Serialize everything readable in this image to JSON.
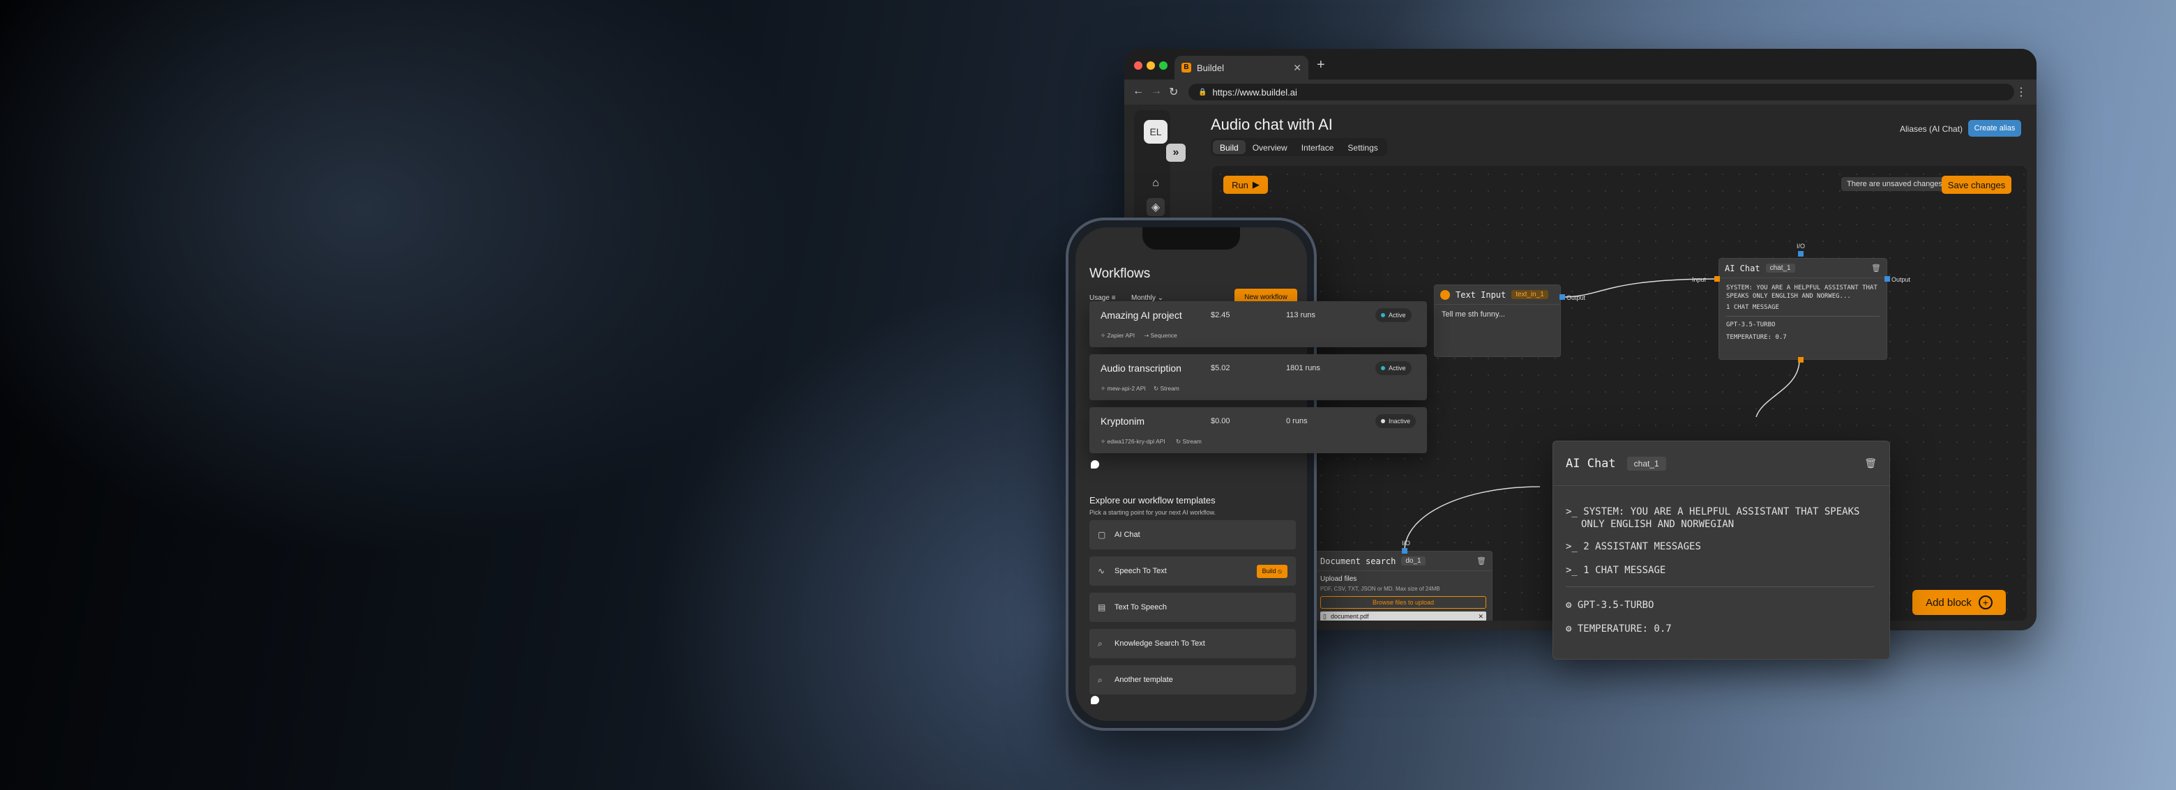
{
  "browser": {
    "tab_title": "Buildel",
    "favicon_letter": "B",
    "url": "https://www.buildel.ai",
    "new_tab_icon": "+",
    "traffic_lights": [
      "#ff5f57",
      "#febc2e",
      "#28c840"
    ]
  },
  "app": {
    "avatar": "EL",
    "page_title": "Audio chat with AI",
    "tabs": [
      {
        "label": "Build",
        "active": true
      },
      {
        "label": "Overview",
        "active": false
      },
      {
        "label": "Interface",
        "active": false
      },
      {
        "label": "Settings",
        "active": false
      }
    ],
    "aliases_label": "Aliases (AI Chat)",
    "create_alias": "Create alias",
    "run_label": "Run",
    "unsaved_text": "There are unsaved changes",
    "save_label": "Save changes",
    "add_block_label": "Add block",
    "accent": "#f08c00"
  },
  "nodes": {
    "text_input": {
      "title": "Text Input",
      "tag": "text_in_1",
      "body": "Tell me sth funny...",
      "output_label": "Output"
    },
    "ai_chat_small": {
      "title": "AI Chat",
      "tag": "chat_1",
      "io_label": "I/O",
      "input_label": "Input",
      "output_label": "Output",
      "system": "SYSTEM: YOU ARE A HELPFUL ASSISTANT THAT SPEAKS ONLY ENGLISH AND NORWEG...",
      "messages": "1 CHAT MESSAGE",
      "model": "GPT-3.5-TURBO",
      "temperature": "TEMPERATURE: 0.7"
    },
    "document_search": {
      "title": "Document search",
      "tag": "do_1",
      "io_label": "I/O",
      "upload_title": "Upload files",
      "upload_hint": "PDF, CSV, TXT, JSON or MD. Max size of 24MB",
      "browse_label": "Browse files to upload",
      "file_name": "document.pdf"
    }
  },
  "big_card": {
    "title": "AI Chat",
    "tag": "chat_1",
    "system": "SYSTEM: YOU ARE A HELPFUL ASSISTANT THAT SPEAKS",
    "system2": "ONLY ENGLISH AND NORWEGIAN",
    "assistant": "2 ASSISTANT MESSAGES",
    "chat": "1 CHAT MESSAGE",
    "model": "GPT-3.5-TURBO",
    "temperature": "TEMPERATURE: 0.7"
  },
  "phone": {
    "title": "Workflows",
    "usage_label": "Usage",
    "period_label": "Monthly",
    "new_workflow": "New workflow",
    "workflows": [
      {
        "name": "Amazing AI project",
        "price": "$2.45",
        "runs": "113 runs",
        "status": "Active",
        "status_color": "#2fb3c4",
        "meta1": "Zapier API",
        "meta2": "Sequence"
      },
      {
        "name": "Audio transcription",
        "price": "$5.02",
        "runs": "1801 runs",
        "status": "Active",
        "status_color": "#2fb3c4",
        "meta1": "mew-api-2 API",
        "meta2": "Stream"
      },
      {
        "name": "Kryptonim",
        "price": "$0.00",
        "runs": "0 runs",
        "status": "Inactive",
        "status_color": "#dddddd",
        "meta1": "edwa1726-kry-dpl API",
        "meta2": "Stream"
      }
    ],
    "templates_title": "Explore our workflow templates",
    "templates_subtitle": "Pick a starting point for your next AI workflow.",
    "templates": [
      {
        "label": "AI Chat",
        "icon": "chat-icon"
      },
      {
        "label": "Speech To Text",
        "icon": "wave-icon",
        "build": "Build"
      },
      {
        "label": "Text To Speech",
        "icon": "doc-icon"
      },
      {
        "label": "Knowledge Search To Text",
        "icon": "search-icon"
      },
      {
        "label": "Another template",
        "icon": "search-icon"
      }
    ]
  }
}
